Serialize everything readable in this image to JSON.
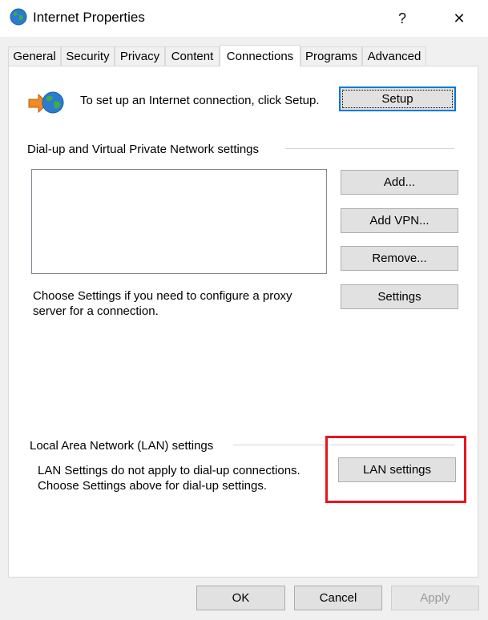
{
  "window": {
    "title": "Internet Properties",
    "help_label": "?",
    "close_label": "✕"
  },
  "tabs": [
    {
      "label": "General",
      "active": false
    },
    {
      "label": "Security",
      "active": false
    },
    {
      "label": "Privacy",
      "active": false
    },
    {
      "label": "Content",
      "active": false
    },
    {
      "label": "Connections",
      "active": true
    },
    {
      "label": "Programs",
      "active": false
    },
    {
      "label": "Advanced",
      "active": false
    }
  ],
  "setup": {
    "description": "To set up an Internet connection, click Setup.",
    "button_label": "Setup",
    "icon": "internet-connection-icon"
  },
  "dialup": {
    "group_label": "Dial-up and Virtual Private Network settings",
    "add_label": "Add...",
    "add_vpn_label": "Add VPN...",
    "remove_label": "Remove...",
    "settings_label": "Settings",
    "proxy_note": "Choose Settings if you need to configure a proxy server for a connection."
  },
  "lan": {
    "group_label": "Local Area Network (LAN) settings",
    "note_line1": "LAN Settings do not apply to dial-up connections.",
    "note_line2": "Choose Settings above for dial-up settings.",
    "button_label": "LAN settings"
  },
  "footer": {
    "ok_label": "OK",
    "cancel_label": "Cancel",
    "apply_label": "Apply"
  },
  "colors": {
    "highlight": "#e8141e",
    "default_button_border": "#0078d7"
  }
}
